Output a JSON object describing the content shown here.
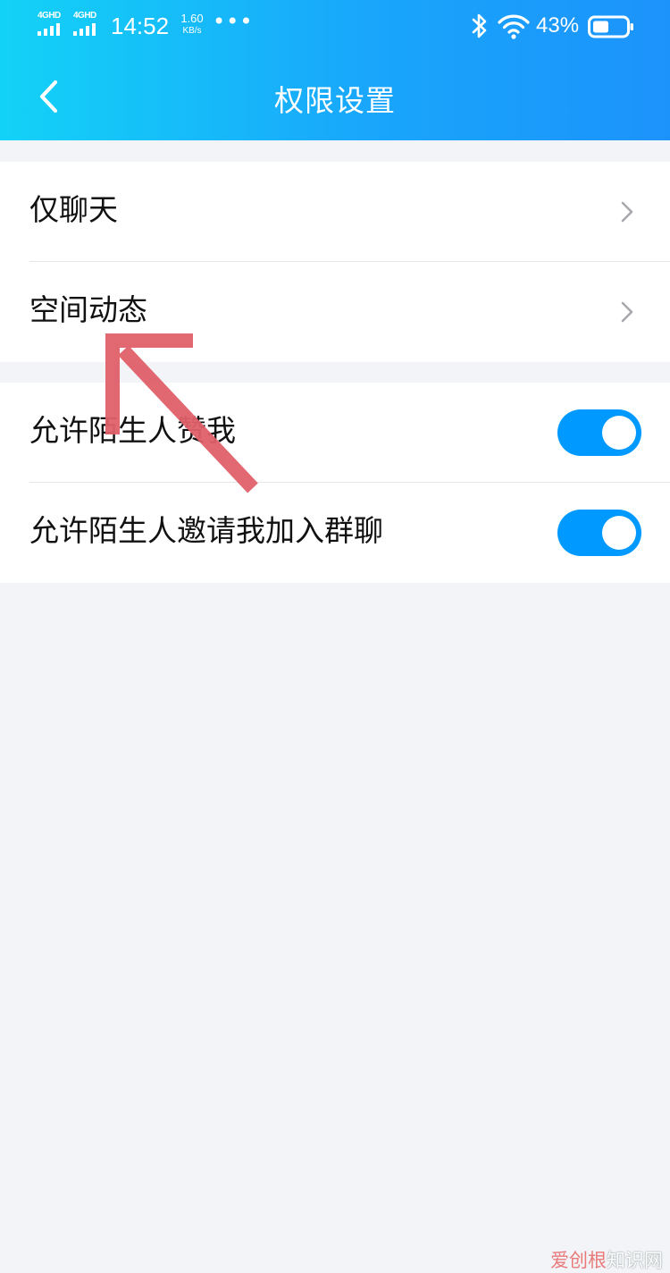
{
  "status_bar": {
    "network_1": "4GHD",
    "network_2": "4GHD",
    "time": "14:52",
    "speed_value": "1.60",
    "speed_unit": "KB/s",
    "more": "•••",
    "battery_percent": "43%",
    "battery_level": 0.43,
    "icons": [
      "signal-icon",
      "bluetooth-icon",
      "wifi-icon",
      "battery-icon"
    ]
  },
  "header": {
    "title": "权限设置",
    "back_icon": "chevron-left-icon",
    "gradient_start": "#13d2f7",
    "gradient_end": "#1c93fb"
  },
  "settings": {
    "group1": [
      {
        "label": "仅聊天",
        "control": "chevron"
      },
      {
        "label": "空间动态",
        "control": "chevron"
      }
    ],
    "group2": [
      {
        "label": "允许陌生人赞我",
        "control": "toggle",
        "on": true
      },
      {
        "label": "允许陌生人邀请我加入群聊",
        "control": "toggle",
        "on": true
      }
    ]
  },
  "colors": {
    "toggle_on": "#0099ff",
    "annotation_arrow": "#e0606a",
    "background": "#f3f4f8"
  },
  "watermark": {
    "part1": "爱创根",
    "part2": "知识网"
  }
}
